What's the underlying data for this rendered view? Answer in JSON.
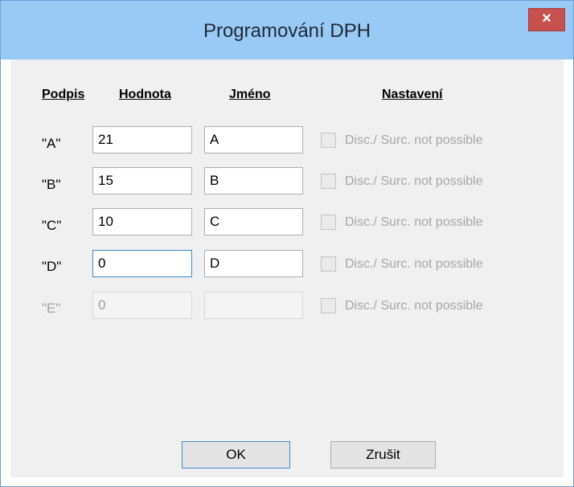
{
  "window": {
    "title": "Programování DPH",
    "close_glyph": "×"
  },
  "headers": {
    "podpis": "Podpis",
    "hodnota": "Hodnota",
    "jmeno": "Jméno",
    "nastaveni": "Nastavení"
  },
  "rows": [
    {
      "label": "\"A\"",
      "value": "21",
      "name": "A",
      "setting": "Disc./ Surc. not possible",
      "enabled": true,
      "focused": false
    },
    {
      "label": "\"B\"",
      "value": "15",
      "name": "B",
      "setting": "Disc./ Surc. not possible",
      "enabled": true,
      "focused": false
    },
    {
      "label": "\"C\"",
      "value": "10",
      "name": "C",
      "setting": "Disc./ Surc. not possible",
      "enabled": true,
      "focused": false
    },
    {
      "label": "\"D\"",
      "value": "0",
      "name": "D",
      "setting": "Disc./ Surc. not possible",
      "enabled": true,
      "focused": true
    },
    {
      "label": "\"E\"",
      "value": "0",
      "name": "",
      "setting": "Disc./ Surc. not possible",
      "enabled": false,
      "focused": false
    }
  ],
  "buttons": {
    "ok": "OK",
    "cancel": "Zrušit"
  },
  "colors": {
    "titlebar": "#99c9f5",
    "close": "#c7514f",
    "dialog_bg": "#f0f0f0",
    "focus_border": "#3f8ad0"
  }
}
